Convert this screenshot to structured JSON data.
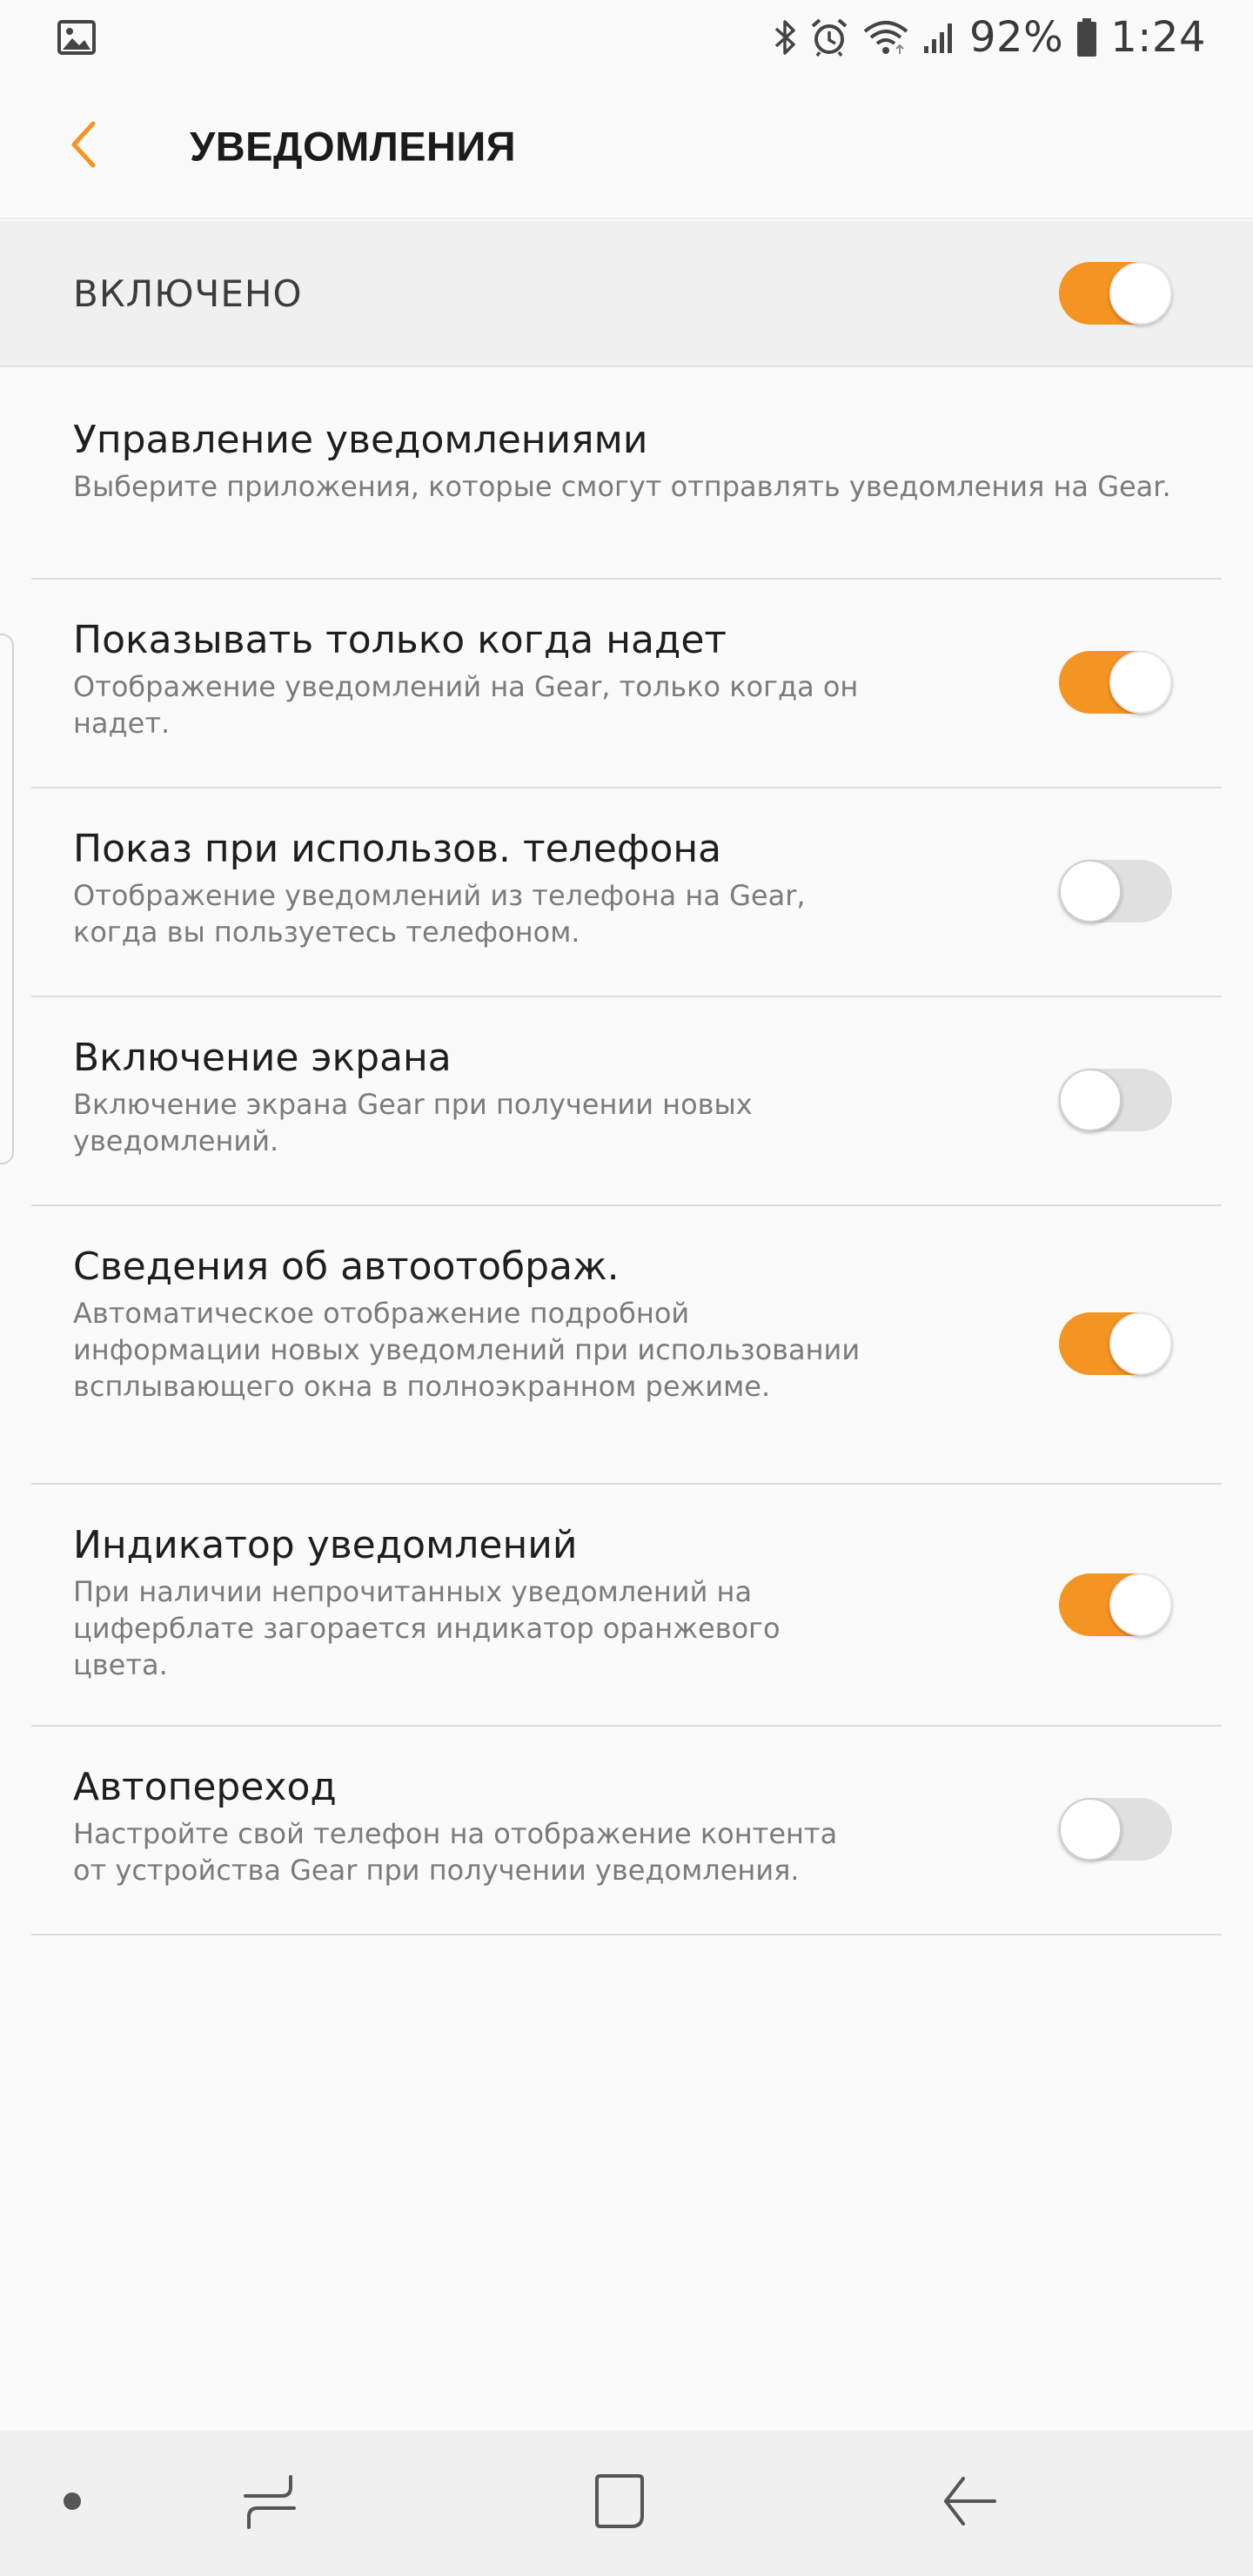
{
  "status_bar": {
    "battery_percent": "92%",
    "time": "1:24",
    "icons": [
      "image-icon",
      "bluetooth-icon",
      "alarm-icon",
      "wifi-icon",
      "signal-icon",
      "battery-icon"
    ]
  },
  "header": {
    "title": "УВЕДОМЛЕНИЯ",
    "back_icon": "chevron-left-icon"
  },
  "master": {
    "label": "ВКЛЮЧЕНО",
    "enabled": true
  },
  "settings": [
    {
      "title": "Управление уведомлениями",
      "subtitle": "Выберите приложения, которые смогут отправлять уведомления на Gear.",
      "has_toggle": false
    },
    {
      "title": "Показывать только когда надет",
      "subtitle": "Отображение уведомлений на Gear, только когда он надет.",
      "has_toggle": true,
      "enabled": true
    },
    {
      "title": "Показ при использов. телефона",
      "subtitle": "Отображение уведомлений из телефона на Gear, когда вы пользуетесь телефоном.",
      "has_toggle": true,
      "enabled": false
    },
    {
      "title": "Включение экрана",
      "subtitle": "Включение экрана Gear при получении новых уведомлений.",
      "has_toggle": true,
      "enabled": false
    },
    {
      "title": "Сведения об автоотображ.",
      "subtitle": "Автоматическое отображение подробной информации новых уведомлений при использовании всплывающего окна в полноэкранном режиме.",
      "has_toggle": true,
      "enabled": true
    },
    {
      "title": "Индикатор уведомлений",
      "subtitle": "При наличии непрочитанных уведомлений на циферблате загорается индикатор оранжевого цвета.",
      "has_toggle": true,
      "enabled": true
    },
    {
      "title": "Автопереход",
      "subtitle": "Настройте свой телефон на отображение контента от устройства Gear при получении уведомления.",
      "has_toggle": true,
      "enabled": false
    }
  ],
  "nav_bar": {
    "buttons": [
      "dot-icon",
      "recents-icon",
      "home-icon",
      "back-icon"
    ]
  },
  "colors": {
    "accent": "#f49422",
    "toggle_off": "#e0e0e0",
    "background": "#fafafa"
  }
}
